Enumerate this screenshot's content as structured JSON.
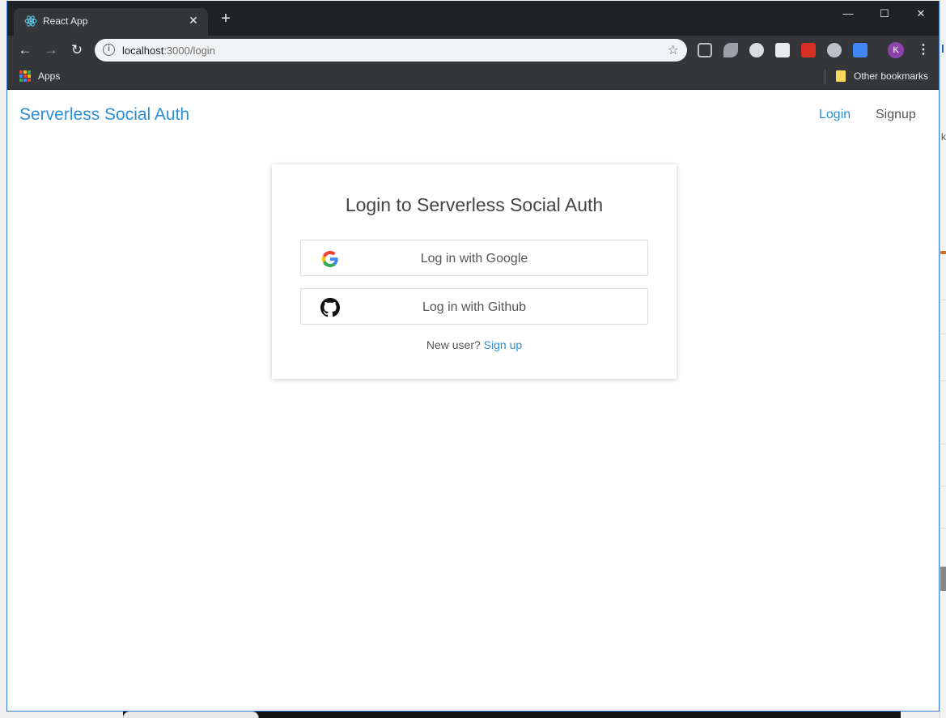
{
  "browser": {
    "tab_title": "React App",
    "tab_close_icon": "close-icon",
    "new_tab_icon": "plus-icon",
    "url_host": "localhost",
    "url_rest": ":3000/login",
    "profile_initial": "K",
    "bookmarks": {
      "apps_label": "Apps",
      "other_label": "Other bookmarks"
    }
  },
  "navbar": {
    "brand": "Serverless Social Auth",
    "login": "Login",
    "signup": "Signup"
  },
  "login_card": {
    "title": "Login to Serverless Social Auth",
    "google_label": "Log in with Google",
    "github_label": "Log in with Github",
    "new_user_text": "New user?",
    "signup_link": "Sign up"
  },
  "colors": {
    "accent": "#2d8fd6",
    "browser_dark": "#202124",
    "toolbar": "#35363a"
  }
}
